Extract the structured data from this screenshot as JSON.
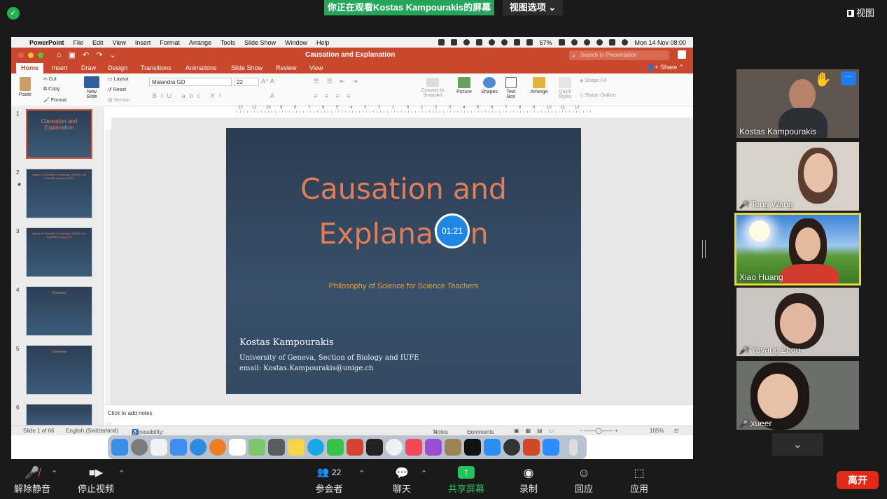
{
  "zoom": {
    "banner": "你正在观看Kostas  Kampourakis的屏幕",
    "view_options": "视图选项 ⌄",
    "view": "视图",
    "controls": {
      "unmute": "解除静音",
      "stop_video": "停止视频",
      "participants": "参会者",
      "participant_count": "22",
      "chat": "聊天",
      "share_screen": "共享屏幕",
      "record": "录制",
      "react": "回应",
      "apps": "应用",
      "leave": "离开"
    },
    "participants": [
      {
        "name": "Kostas Kampourakis",
        "muted": false
      },
      {
        "name": "Tong Wang",
        "muted": true
      },
      {
        "name": "Xiao Huang",
        "muted": false
      },
      {
        "name": "Yuyang Zhou",
        "muted": true
      },
      {
        "name": "xueer",
        "muted": true
      }
    ],
    "more_label": "···"
  },
  "mac_menu": {
    "app": "PowerPoint",
    "items": [
      "File",
      "Edit",
      "View",
      "Insert",
      "Format",
      "Arrange",
      "Tools",
      "Slide Show",
      "Window",
      "Help"
    ],
    "battery": "67%",
    "datetime": "Mon 14 Nov  08:00"
  },
  "ppt": {
    "doc_title": "Causation and Explanation",
    "search_placeholder": "Search in Presentation",
    "tabs": [
      "Home",
      "Insert",
      "Draw",
      "Design",
      "Transitions",
      "Animations",
      "Slide Show",
      "Review",
      "View"
    ],
    "share": "Share",
    "ribbon": {
      "paste": "Paste",
      "cut": "Cut",
      "copy": "Copy",
      "format": "Format",
      "new_slide": "New Slide",
      "layout": "Layout",
      "reset": "Reset",
      "section": "Section",
      "font": "Maiandra GD",
      "size": "22",
      "convert": "Convert to SmartArt",
      "picture": "Picture",
      "shapes": "Shapes",
      "text_box": "Text Box",
      "arrange": "Arrange",
      "quick_styles": "Quick Styles",
      "shape_fill": "Shape Fill",
      "shape_outline": "Shape Outline"
    },
    "ruler_labels": [
      "12",
      "11",
      "10",
      "9",
      "8",
      "7",
      "6",
      "5",
      "4",
      "3",
      "2",
      "1",
      "0",
      "1",
      "2",
      "3",
      "4",
      "5",
      "6",
      "7",
      "8",
      "9",
      "10",
      "11",
      "12"
    ],
    "thumbnails": [
      {
        "num": "1",
        "title": "Causation and Explanation"
      },
      {
        "num": "2",
        "title": "Nature of Scientific Knowledge (NOSK) and Scientific Inquiry (NOSI)"
      },
      {
        "num": "3",
        "title": "Nature of Scientific Knowledge (NOSK) and Scientific Inquiry (SI)"
      },
      {
        "num": "4",
        "title": "Overview"
      },
      {
        "num": "5",
        "title": "Overview"
      },
      {
        "num": "6",
        "title": ""
      }
    ],
    "slide": {
      "title_line1": "Causation and",
      "title_line2": "Explanation",
      "subtitle": "Philosophy of Science for Science Teachers",
      "author": "Kostas Kampourakis",
      "affiliation": "University of Geneva, Section of Biology and IUFE",
      "email": "email: Kostas.Kampourakis@unige.ch"
    },
    "timer": "01:21",
    "notes_placeholder": "Click to add notes",
    "status": {
      "slide": "Slide 1 of 66",
      "lang": "English (Switzerland)",
      "accessibility": "Accessibility: Unavailable",
      "notes": "Notes",
      "comments": "Comments",
      "zoom": "105%"
    }
  }
}
